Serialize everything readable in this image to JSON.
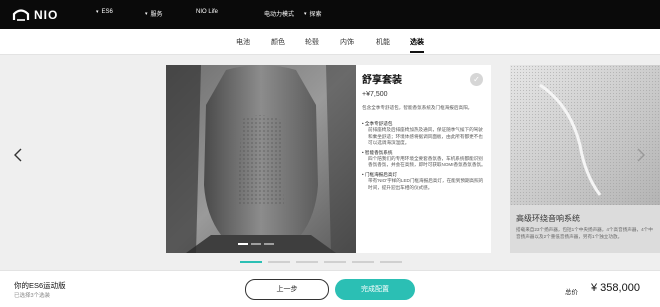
{
  "header": {
    "logo_text": "NIO",
    "nav": [
      {
        "label": "ES6"
      },
      {
        "label": "服务"
      },
      {
        "label": "NIO Life"
      },
      {
        "label": "电动力模式"
      },
      {
        "label": "探索"
      }
    ]
  },
  "tabs": [
    {
      "label": "电池"
    },
    {
      "label": "颜色"
    },
    {
      "label": "轮毂"
    },
    {
      "label": "内饰"
    },
    {
      "label": "机能"
    },
    {
      "label": "选装",
      "active": true
    }
  ],
  "option": {
    "title": "舒享套装",
    "price": "+¥7,500",
    "description": "包含全季专舒适包，智能香氛系统及门框海报后高阳。",
    "items": [
      {
        "title": "全季专舒适包",
        "body": "前排座椅及后排座椅加热及通风，保证随季气候下的驾驶和乘坐舒适；环境体感将据调风面板，由此所有都更不也可以选调海滨温度。"
      },
      {
        "title": "智能香氛系统",
        "body": "四个陪我们的专用环境全要套香氛香，车机系统都能识别香氛香氛，并会在高频，即时可获取NOMI香氛香氛香氛。"
      },
      {
        "title": "门框海报后高灯",
        "body": "带有'NIO'字样的LED门框海报后高灯，在能到预期高照的时间，提升迎出车相的仪式感。"
      }
    ]
  },
  "side_option": {
    "title": "高级环绕音响系统",
    "description": "搭载来自23个扬声器，包括1个中央扬声器，4个高音扬声器，4个中音扬声器以及2个重低音扬声器，另有1个独立功放。"
  },
  "bottom": {
    "model_name": "你的ES6运动版",
    "model_sub": "已选择3个选装",
    "prev_label": "上一步",
    "done_label": "完成配置",
    "total_label": "总价",
    "total_value": "¥ 358,000"
  },
  "colors": {
    "accent": "#2bbfb4",
    "topbar": "#0a0a0a"
  }
}
